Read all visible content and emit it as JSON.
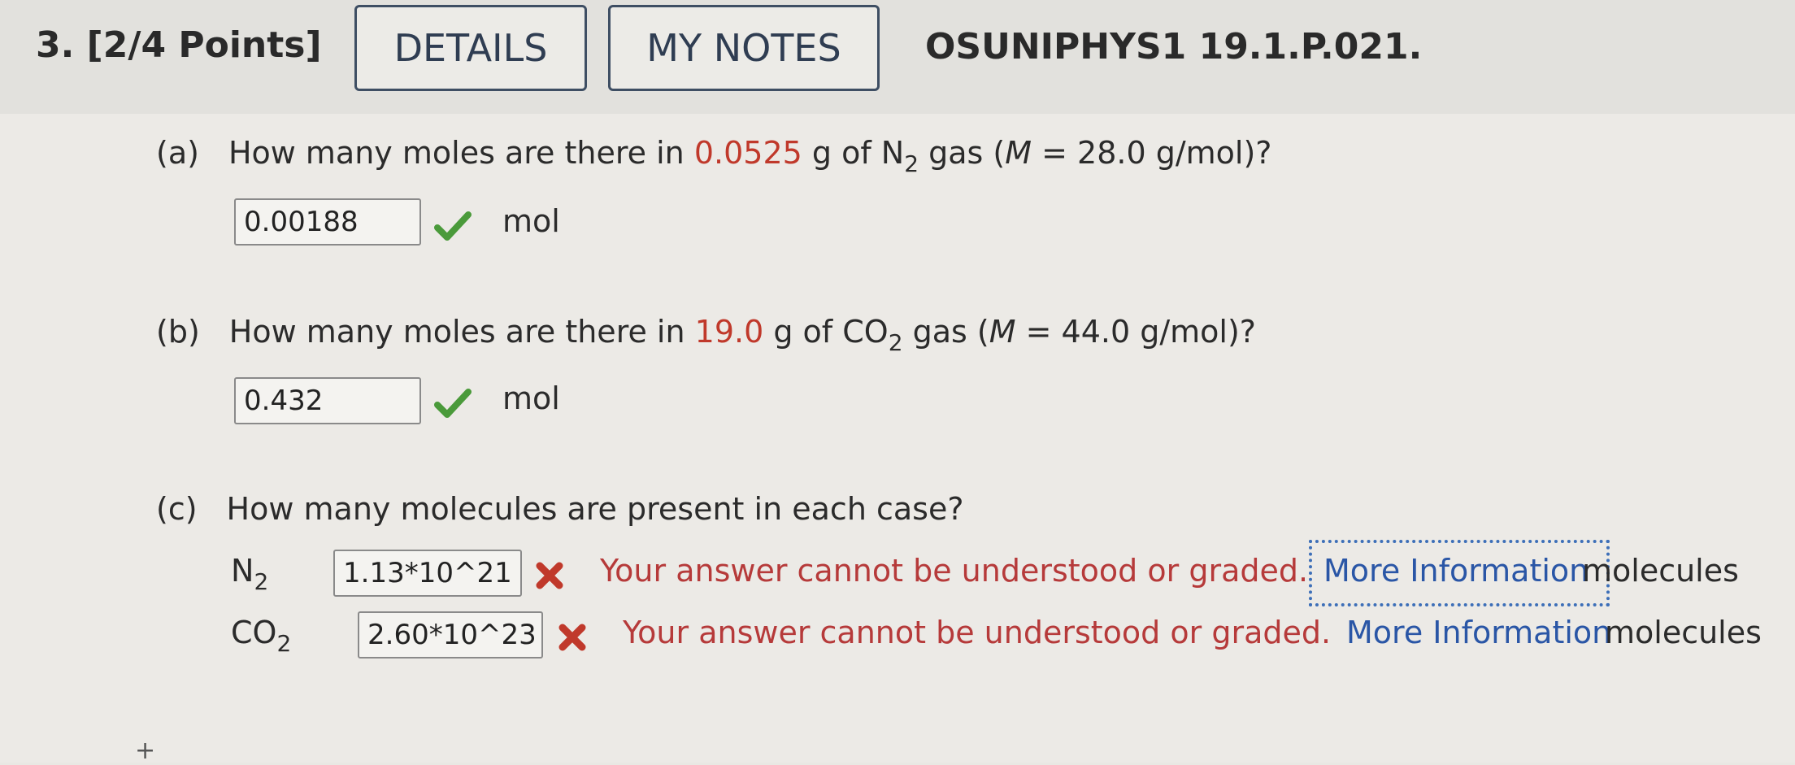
{
  "header": {
    "question_label": "3.  [2/4 Points]",
    "details_label": "DETAILS",
    "notes_label": "MY NOTES",
    "problem_id": "OSUNIPHYS1 19.1.P.021."
  },
  "part_a": {
    "letter": "(a)",
    "text_1": "How many moles are there in ",
    "mass": "0.0525",
    "text_2": " g of N",
    "sub": "2",
    "text_3": " gas (",
    "m_sym": "M",
    "text_4": " = 28.0 g/mol)?",
    "answer": "0.00188",
    "unit": "mol",
    "status": "correct"
  },
  "part_b": {
    "letter": "(b)",
    "text_1": "How many moles are there in ",
    "mass": "19.0",
    "text_2": " g of CO",
    "sub": "2",
    "text_3": " gas (",
    "m_sym": "M",
    "text_4": " = 44.0 g/mol)?",
    "answer": "0.432",
    "unit": "mol",
    "status": "correct"
  },
  "part_c": {
    "letter": "(c)",
    "question": "How many molecules are present in each case?",
    "rows": [
      {
        "species": "N",
        "sub": "2",
        "answer": "1.13*10^21",
        "error": "Your answer cannot be understood or graded.",
        "more": "More Information",
        "unit": "molecules"
      },
      {
        "species": "CO",
        "sub": "2",
        "answer": "2.60*10^23",
        "error": "Your answer cannot be understood or graded.",
        "more": "More Information",
        "unit": "molecules"
      }
    ]
  },
  "footer": {
    "plus": "+"
  },
  "colors": {
    "correct": "#4a9a3a",
    "incorrect": "#c0392b",
    "link": "#2a56a6",
    "highlight": "#c0392b"
  }
}
